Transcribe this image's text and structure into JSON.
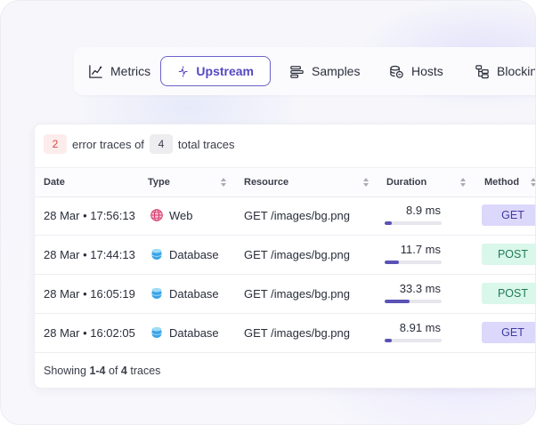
{
  "tabs": [
    {
      "id": "metrics",
      "label": "Metrics",
      "icon": "line-chart-icon",
      "active": false
    },
    {
      "id": "upstream",
      "label": "Upstream",
      "icon": "wave-arrows-icon",
      "active": true
    },
    {
      "id": "samples",
      "label": "Samples",
      "icon": "bar-list-icon",
      "active": false
    },
    {
      "id": "hosts",
      "label": "Hosts",
      "icon": "database-stack-icon",
      "active": false
    },
    {
      "id": "blocking",
      "label": "Blocking",
      "icon": "hierarchy-icon",
      "active": false
    }
  ],
  "summary": {
    "error_count": "2",
    "error_text": "error traces of",
    "total_count": "4",
    "total_text": "total traces"
  },
  "columns": {
    "date": "Date",
    "type": "Type",
    "resource": "Resource",
    "duration": "Duration",
    "method": "Method"
  },
  "rows": [
    {
      "date": "28 Mar • 17:56:13",
      "type": "Web",
      "type_icon": "globe-icon",
      "resource": "GET /images/bg.png",
      "duration": "8.9 ms",
      "duration_fraction": 0.12,
      "method": "GET"
    },
    {
      "date": "28 Mar • 17:44:13",
      "type": "Database",
      "type_icon": "database-icon",
      "resource": "GET /images/bg.png",
      "duration": "11.7 ms",
      "duration_fraction": 0.25,
      "method": "POST"
    },
    {
      "date": "28 Mar • 16:05:19",
      "type": "Database",
      "type_icon": "database-icon",
      "resource": "GET /images/bg.png",
      "duration": "33.3 ms",
      "duration_fraction": 0.44,
      "method": "POST"
    },
    {
      "date": "28 Mar • 16:02:05",
      "type": "Database",
      "type_icon": "database-icon",
      "resource": "GET /images/bg.png",
      "duration": "8.91 ms",
      "duration_fraction": 0.12,
      "method": "GET"
    }
  ],
  "footer": {
    "prefix": "Showing",
    "range": "1-4",
    "middle": "of",
    "total": "4",
    "suffix": "traces"
  },
  "colors": {
    "accent": "#5448c2",
    "error": "#d8463e",
    "get_bg": "#dcd8fb",
    "post_bg": "#d9f7ea"
  }
}
